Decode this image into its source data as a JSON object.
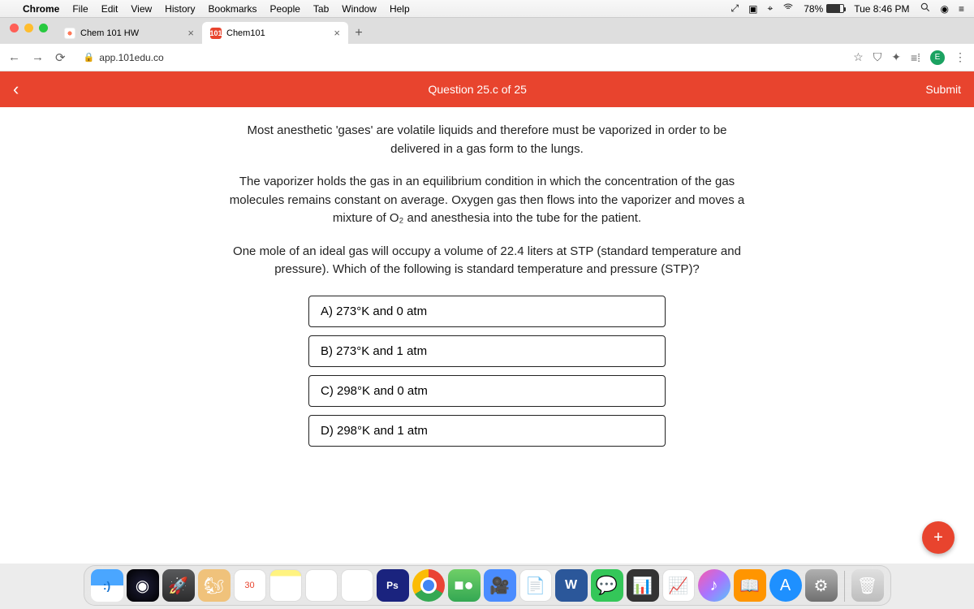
{
  "menubar": {
    "app": "Chrome",
    "items": [
      "File",
      "Edit",
      "View",
      "History",
      "Bookmarks",
      "People",
      "Tab",
      "Window",
      "Help"
    ],
    "battery_pct": "78%",
    "clock": "Tue 8:46 PM"
  },
  "tabs": [
    {
      "title": "Chem 101 HW",
      "active": false
    },
    {
      "title": "Chem101",
      "active": true
    }
  ],
  "url": "app.101edu.co",
  "header": {
    "title": "Question 25.c of 25",
    "submit": "Submit"
  },
  "question": {
    "p1": "Most anesthetic 'gases' are volatile liquids and therefore must be vaporized in order to be delivered in a gas form to the lungs.",
    "p2": "The vaporizer holds the gas in an equilibrium condition in which the concentration of the gas molecules remains constant on average. Oxygen gas then flows into the vaporizer and moves a mixture of O₂ and anesthesia into the tube for the patient.",
    "p3": "One mole of an ideal gas will occupy a volume of 22.4 liters at STP (standard temperature and pressure). Which of the following is standard temperature and pressure (STP)?",
    "choices": [
      "A) 273°K and 0 atm",
      "B) 273°K and 1 atm",
      "C) 298°K and 0 atm",
      "D) 298°K and 1 atm"
    ]
  },
  "fab": "+",
  "calendar_day": "30"
}
